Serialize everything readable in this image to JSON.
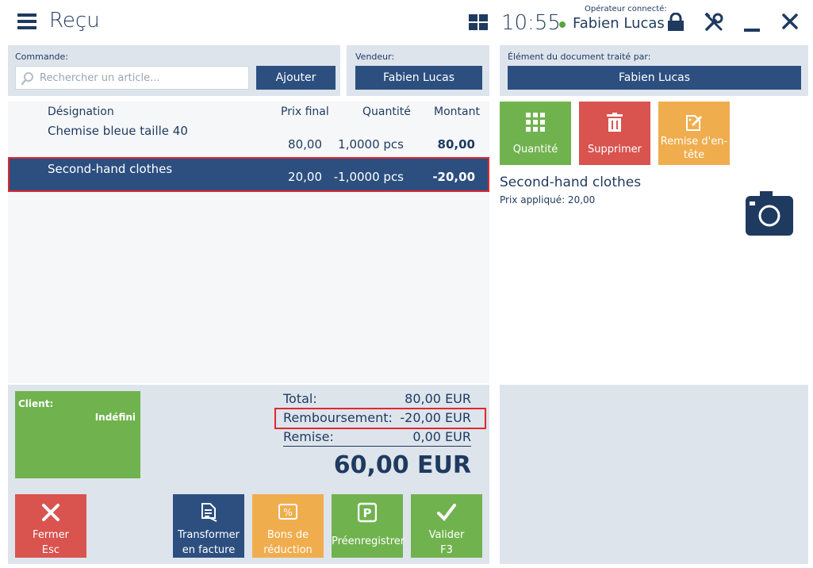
{
  "header": {
    "title": "Reçu",
    "clock": "10:55",
    "operator_label": "Opérateur connecté:",
    "operator_name": "Fabien Lucas"
  },
  "order": {
    "label": "Commande:",
    "search_placeholder": "Rechercher un article...",
    "add_label": "Ajouter"
  },
  "seller": {
    "label": "Vendeur:",
    "name": "Fabien Lucas"
  },
  "processed_by": {
    "label": "Élément du document traité par:",
    "name": "Fabien Lucas"
  },
  "table": {
    "headers": [
      "Désignation",
      "Prix final",
      "Quantité",
      "Montant"
    ],
    "rows": [
      {
        "designation": "Chemise bleue taille 40",
        "prix": "80,00",
        "quantite": "1,0000 pcs",
        "montant": "80,00",
        "selected": false
      },
      {
        "designation": "Second-hand clothes",
        "prix": "20,00",
        "quantite": "-1,0000 pcs",
        "montant": "-20,00",
        "selected": true
      }
    ]
  },
  "tiles": {
    "quantity": "Quantité",
    "delete": "Supprimer",
    "header_discount": "Remise d'en-tête"
  },
  "item_detail": {
    "title": "Second-hand clothes",
    "price_applied": "Prix appliqué: 20,00"
  },
  "client": {
    "label": "Client:",
    "value": "Indéfini"
  },
  "totals": {
    "total_label": "Total:",
    "total_value": "80,00 EUR",
    "refund_label": "Remboursement:",
    "refund_value": "-20,00 EUR",
    "discount_label": "Remise:",
    "discount_value": "0,00 EUR",
    "grand_total": "60,00 EUR"
  },
  "actions": {
    "close": "Fermer",
    "close_key": "Esc",
    "invoice_1": "Transformer",
    "invoice_2": "en facture",
    "vouchers_1": "Bons de",
    "vouchers_2": "réduction",
    "preregister": "Préenregistrer",
    "validate": "Valider",
    "validate_key": "F3"
  },
  "colors": {
    "navy": "#2c4f80",
    "green": "#70b34e",
    "red": "#d9534f",
    "orange": "#f0ad4e",
    "highlight": "#e0282e"
  }
}
